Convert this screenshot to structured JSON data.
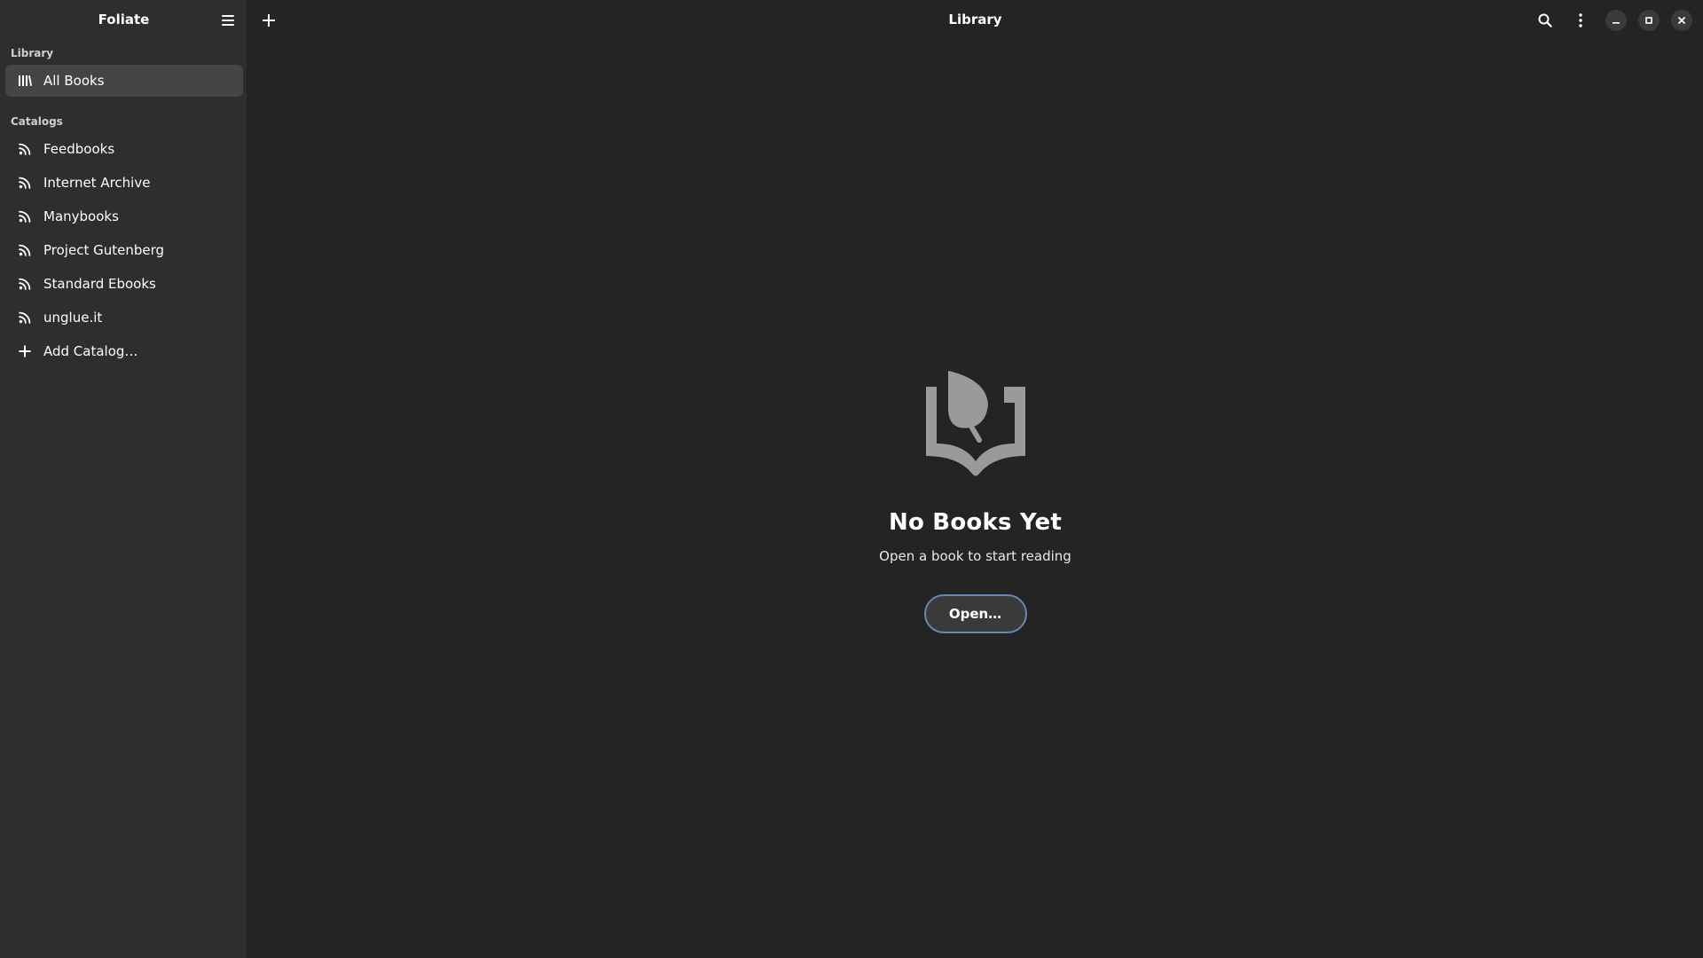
{
  "sidebar": {
    "title": "Foliate",
    "library_label": "Library",
    "library_items": [
      {
        "label": "All Books",
        "icon": "library-icon",
        "active": true
      }
    ],
    "catalogs_label": "Catalogs",
    "catalog_items": [
      {
        "label": "Feedbooks",
        "icon": "rss-icon"
      },
      {
        "label": "Internet Archive",
        "icon": "rss-icon"
      },
      {
        "label": "Manybooks",
        "icon": "rss-icon"
      },
      {
        "label": "Project Gutenberg",
        "icon": "rss-icon"
      },
      {
        "label": "Standard Ebooks",
        "icon": "rss-icon"
      },
      {
        "label": "unglue.it",
        "icon": "rss-icon"
      }
    ],
    "add_catalog_label": "Add Catalog…"
  },
  "header": {
    "title": "Library",
    "icons": [
      "plus-icon",
      "search-icon",
      "kebab-menu-icon",
      "minimize-icon",
      "maximize-icon",
      "close-icon"
    ]
  },
  "empty_state": {
    "icon": "foliate-book-leaf-icon",
    "title": "No Books Yet",
    "subtitle": "Open a book to start reading",
    "button_label": "Open…"
  },
  "colors": {
    "sidebar_bg": "#2e2e2e",
    "main_bg": "#242424",
    "active_item_bg": "#454545",
    "accent_border": "#6b86b7",
    "icon_gray": "#9a9a9a"
  }
}
